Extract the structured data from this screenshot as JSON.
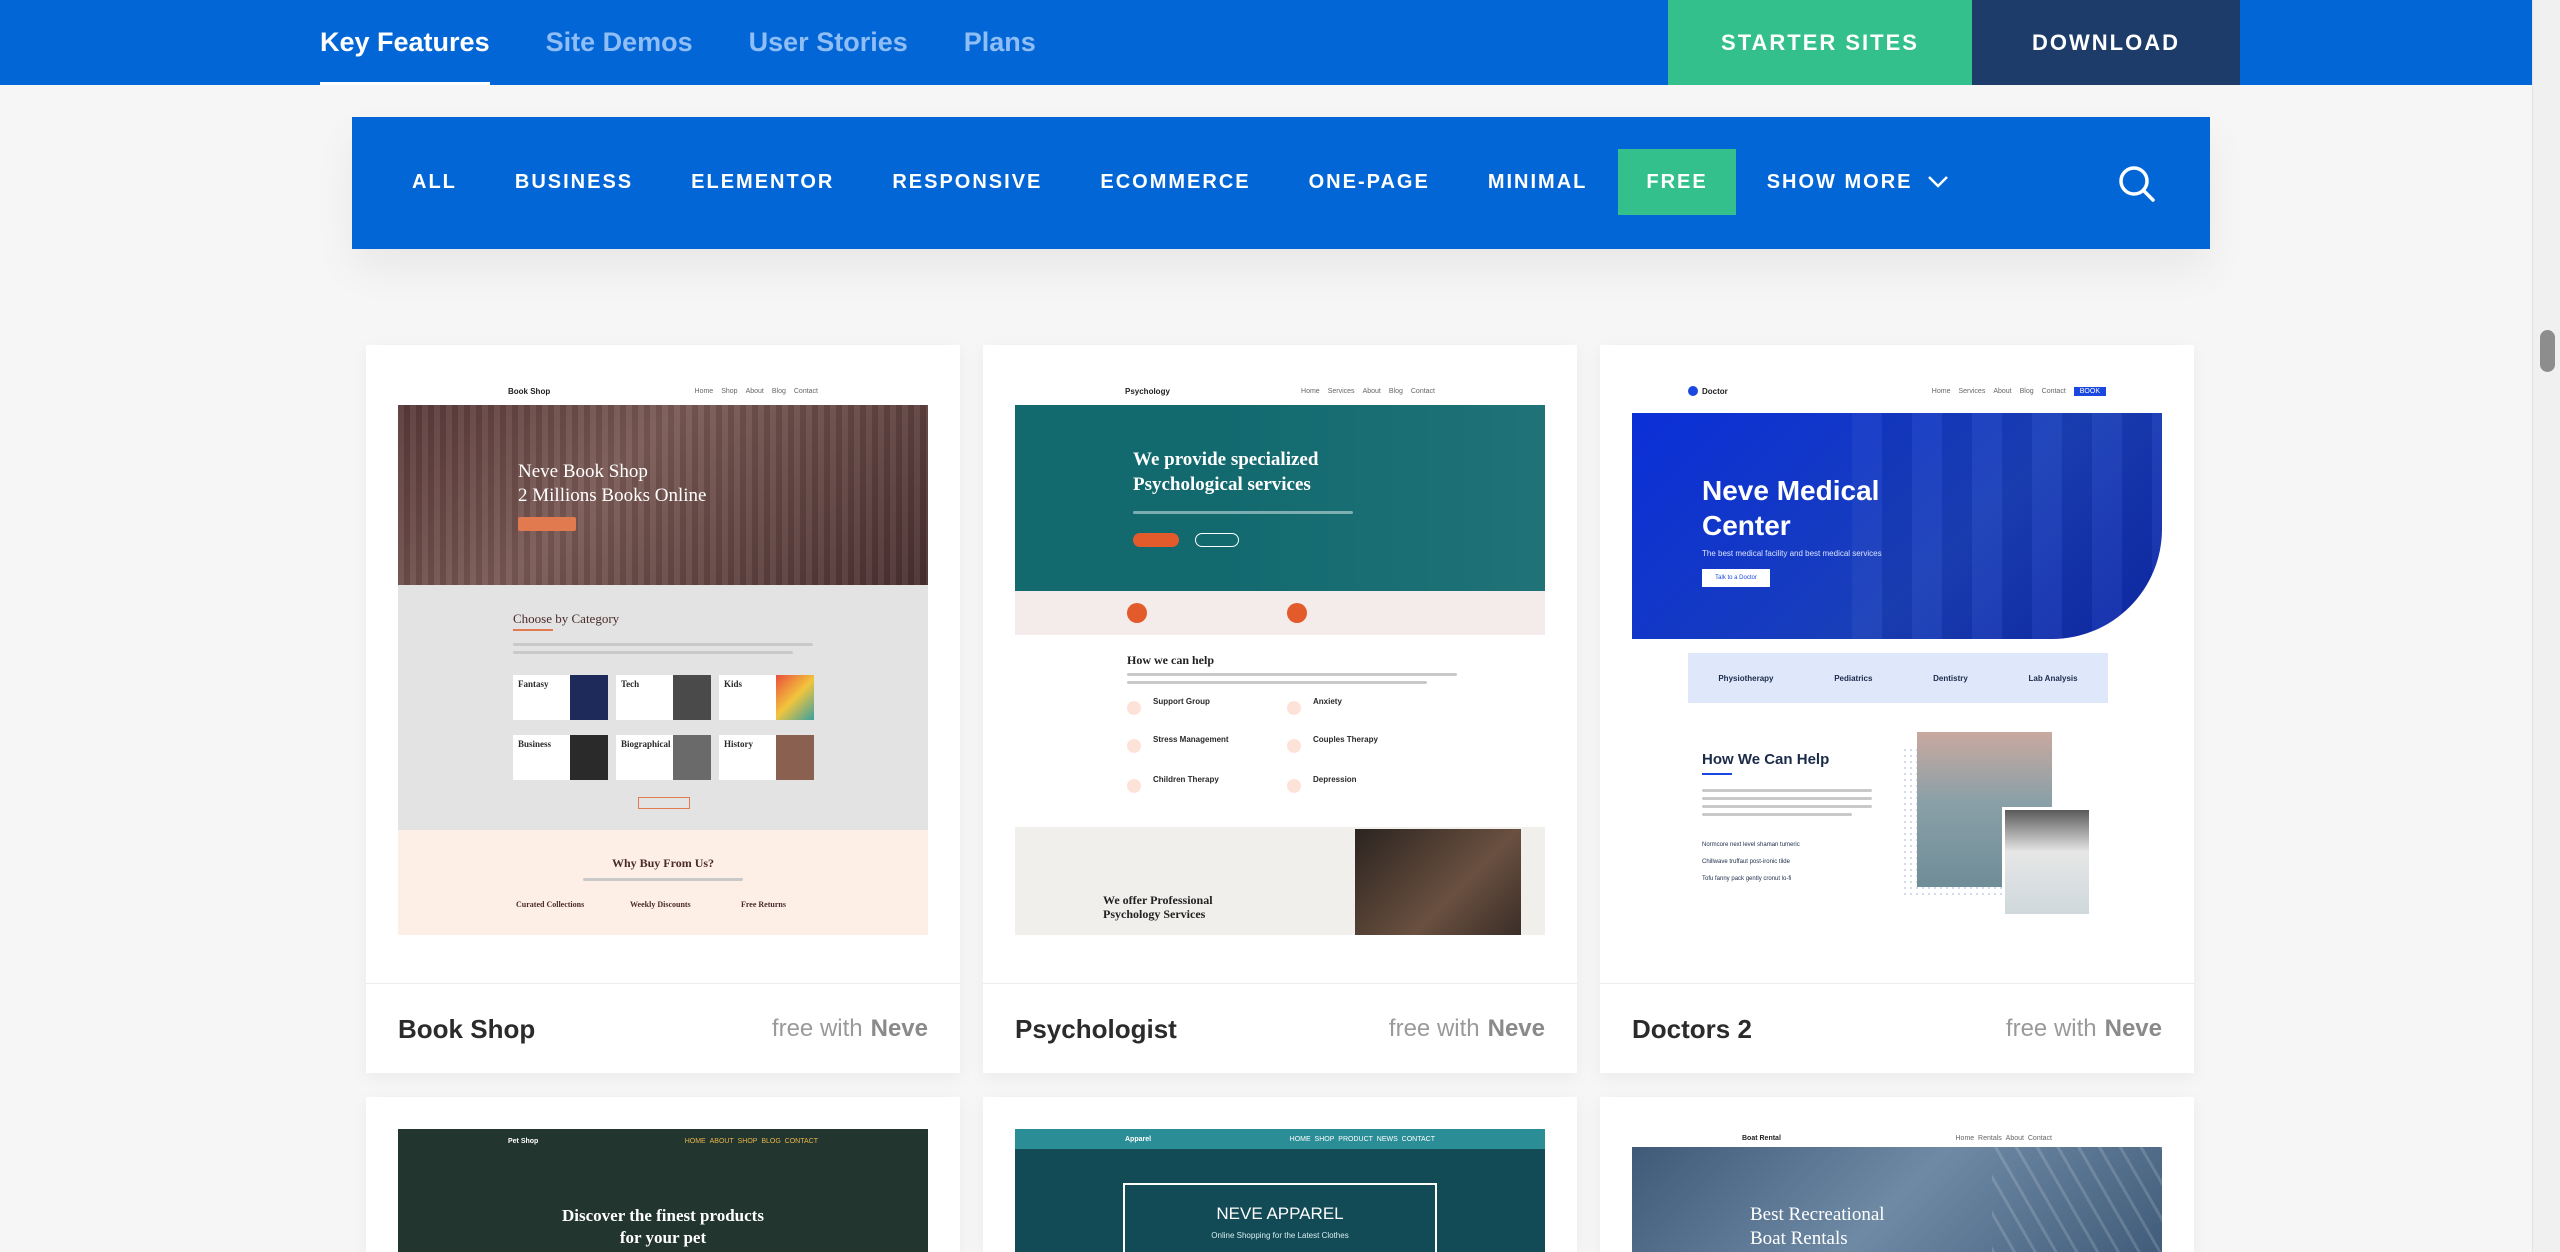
{
  "topnav": {
    "links": [
      "Key Features",
      "Site Demos",
      "User Stories",
      "Plans"
    ],
    "starter_label": "STARTER SITES",
    "download_label": "DOWNLOAD"
  },
  "filters": {
    "items": [
      "ALL",
      "BUSINESS",
      "ELEMENTOR",
      "RESPONSIVE",
      "ECOMMERCE",
      "ONE-PAGE",
      "MINIMAL",
      "FREE"
    ],
    "show_more": "SHOW MORE",
    "active": "FREE"
  },
  "cards": [
    {
      "name": "Book Shop",
      "price_prefix": "free with",
      "price_brand": "Neve",
      "preview": {
        "logo": "Book Shop",
        "hero_line1": "Neve Book Shop",
        "hero_line2": "2 Millions Books Online",
        "section_title": "Choose by Category",
        "categories": [
          "Fantasy",
          "Tech",
          "Kids",
          "Business",
          "Biographical",
          "History"
        ],
        "why_title": "Why Buy From Us?",
        "features": [
          "Curated Collections",
          "Weekly Discounts",
          "Free Returns"
        ]
      }
    },
    {
      "name": "Psychologist",
      "price_prefix": "free with",
      "price_brand": "Neve",
      "preview": {
        "logo": "Psychology",
        "hero_line1": "We provide specialized",
        "hero_line2": "Psychological services",
        "help_title": "How we can help",
        "services": [
          "Support Group",
          "Anxiety",
          "Stress Management",
          "Couples Therapy",
          "Children Therapy",
          "Depression"
        ],
        "offer_line1": "We offer Professional",
        "offer_line2": "Psychology Services"
      }
    },
    {
      "name": "Doctors 2",
      "price_prefix": "free with",
      "price_brand": "Neve",
      "preview": {
        "logo": "Doctor",
        "hero_line1": "Neve Medical",
        "hero_line2": "Center",
        "hero_sub": "The best medical facility and best medical services",
        "hero_btn": "Talk to a Doctor",
        "specialties": [
          "Physiotherapy",
          "Pediatrics",
          "Dentistry",
          "Lab Analysis"
        ],
        "help_title": "How We Can Help",
        "checks": [
          "Normcore next level shaman tumeric",
          "Chillwave truffaut post-ironic tilde",
          "Tofu fanny pack gently cronut lo-fi"
        ]
      }
    },
    {
      "name": "",
      "preview": {
        "logo": "Pet Shop",
        "hero_line1": "Discover the finest products",
        "hero_line2": "for your pet"
      }
    },
    {
      "name": "",
      "preview": {
        "logo": "Apparel",
        "hero_line1": "NEVE APPAREL",
        "hero_line2": "Online Shopping for the Latest Clothes"
      }
    },
    {
      "name": "",
      "preview": {
        "logo": "Boat Rental",
        "hero_line1": "Best Recreational",
        "hero_line2": "Boat Rentals"
      }
    }
  ],
  "colors": {
    "brand_blue": "#0366d6",
    "green": "#33c08d",
    "navy": "#1d3c69"
  }
}
